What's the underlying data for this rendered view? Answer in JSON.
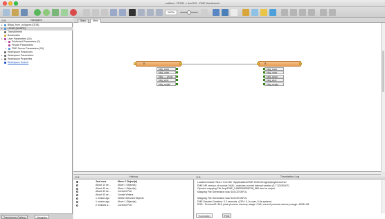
{
  "window": {
    "title": "untitled - FEDB -> ArcGIS - FME Workbench"
  },
  "toolbar": {
    "zoom_value": "100%"
  },
  "navigator": {
    "title": "Navigator",
    "items": [
      {
        "label": "Bldgs_from_polygons [GDB]",
        "indent": 1,
        "arrow": "▸",
        "icon_color": "#4a8fd6"
      },
      {
        "label": "LIDAR [SHAPE]",
        "indent": 1,
        "arrow": "▸",
        "icon_color": "#4a8fd6",
        "selected": true
      },
      {
        "label": "Transformers",
        "indent": 1,
        "arrow": "",
        "icon_color": "#6a6a6a"
      },
      {
        "label": "Bookmarks",
        "indent": 1,
        "arrow": "",
        "icon_color": "#d9a53a"
      },
      {
        "label": "User Parameters (18)",
        "indent": 1,
        "arrow": "▾",
        "icon_color": "#b43c9b"
      },
      {
        "label": "Published Parameters (0)",
        "indent": 2,
        "arrow": "▸",
        "icon_color": "#b43c9b"
      },
      {
        "label": "Private Parameters",
        "indent": 2,
        "arrow": "",
        "icon_color": "#b43c9b"
      },
      {
        "label": "FME Server Parameters (18)",
        "indent": 2,
        "arrow": "▸",
        "icon_color": "#4a8fd6"
      },
      {
        "label": "Workspace Resources",
        "indent": 1,
        "arrow": "",
        "icon_color": "#6a6a6a"
      },
      {
        "label": "Workspace Parameters",
        "indent": 1,
        "arrow": "▸",
        "icon_color": "#6a6a6a"
      },
      {
        "label": "Workspace Properties",
        "indent": 1,
        "arrow": "▸",
        "icon_color": "#6a6a6a"
      },
      {
        "label": "Workspace Search",
        "indent": 1,
        "arrow": "",
        "icon_color": "#1a55c8",
        "link": true
      }
    ]
  },
  "bottom_tabs": [
    "Transformer Gallery",
    "Navigator"
  ],
  "main_tabs": [
    "Start",
    "Main"
  ],
  "canvas": {
    "reader": {
      "name": "B",
      "attributes": [
        "bldg_class",
        "bldg_order",
        "bldg_..._group",
        "bldg_style",
        "bldg_weight"
      ]
    },
    "writer": {
      "name": "B",
      "attributes": [
        "bldg_class",
        "bldg_order",
        "bldg_group",
        "bldg_style",
        "bldg_weight"
      ]
    }
  },
  "history": {
    "title": "History",
    "rows": [
      {
        "time": "Just now",
        "action": "Move 2 Object(s)",
        "bold": true,
        "filled": true
      },
      {
        "time": "About 10 se...",
        "action": "Move 1 Object(s)",
        "bold": false,
        "filled": false
      },
      {
        "time": "About 40 se...",
        "action": "Move 1 Object(s)",
        "bold": false,
        "filled": false
      },
      {
        "time": "About 40 se...",
        "action": "Connect Port",
        "bold": false,
        "filled": false
      },
      {
        "time": "About 40 se...",
        "action": "Create Writers",
        "bold": false,
        "filled": false
      },
      {
        "time": "1 minute ago",
        "action": "Delete Selected Objects",
        "bold": false,
        "filled": false
      },
      {
        "time": "1 minute ago",
        "action": "Move 1 Object(s)",
        "bold": false,
        "filled": false
      },
      {
        "time": "2 minutes a...",
        "action": "Connect Port",
        "bold": false,
        "filled": false
      }
    ]
  },
  "translation_log": {
    "title": "Translation Log",
    "lines": [
      "Loaded module 'NULL' from file '/Applications/FME 2015.0/engine/plugins/null.so'",
      "FME API version of module 'NULL' matches current internal version (3.7 20150407)",
      "Opened mapping File /tmp/FME_14583908098798_589 free for output",
      "Mapping File Generation was SUCCESSFUL",
      "",
      "Mapping File Generation was SUCCESSFUL",
      "FME Session Duration: 0.2 seconds. (CPU: 0.1s user, 0.0s system)",
      "END - ProcessID: 844, peak process memory usage: 0 kB, current process memory usage: 45284 kB"
    ],
    "tabs": [
      "Translation Log",
      "Find"
    ]
  }
}
